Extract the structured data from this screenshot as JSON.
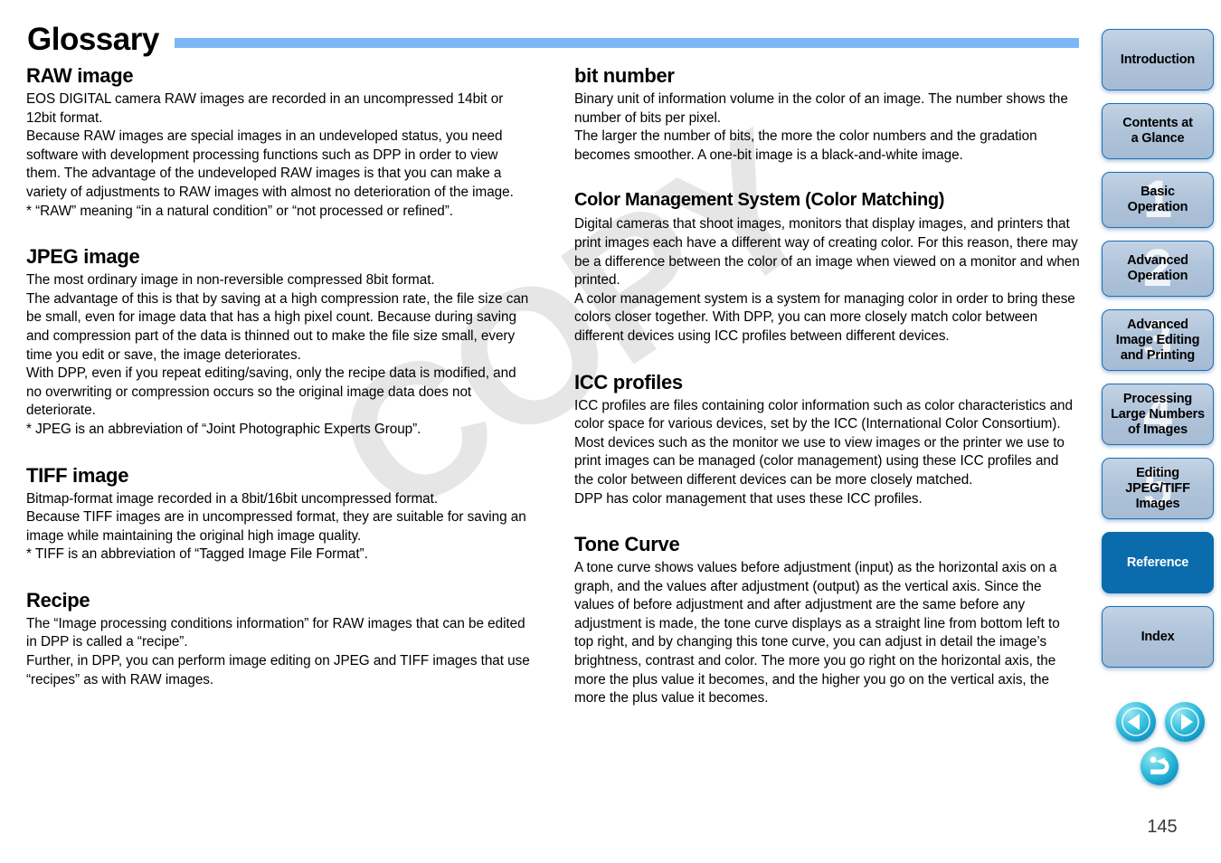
{
  "page": {
    "title": "Glossary",
    "page_number": "145",
    "watermark": "COPY",
    "rule_color": "#7db6f5"
  },
  "left_column": [
    {
      "heading": "RAW image",
      "paragraphs": [
        "EOS DIGITAL camera RAW images are recorded in an uncompressed 14bit or 12bit format.",
        "Because RAW images are special images in an undeveloped status, you need software with development processing functions such as DPP in order to view them. The advantage of the undeveloped RAW images is that you can make a variety of adjustments to RAW images with almost no deterioration of the image.",
        "* “RAW” meaning “in a natural condition” or “not processed or refined”."
      ]
    },
    {
      "heading": "JPEG image",
      "paragraphs": [
        "The most ordinary image in non-reversible compressed 8bit format.",
        "The advantage of this is that by saving at a high compression rate, the file size can be small, even for image data that has a high pixel count. Because during saving and compression part of the data is thinned out to make the file size small, every time you edit or save, the image deteriorates.",
        "With DPP, even if you repeat editing/saving, only the recipe data is modified, and no overwriting or compression occurs so the original image data does not deteriorate.",
        "* JPEG is an abbreviation of “Joint Photographic Experts Group”."
      ]
    },
    {
      "heading": "TIFF image",
      "paragraphs": [
        "Bitmap-format image recorded in a 8bit/16bit uncompressed format.",
        "Because TIFF images are in uncompressed format, they are suitable for saving an image while maintaining the original high image quality.",
        "* TIFF is an abbreviation of “Tagged Image File Format”."
      ]
    },
    {
      "heading": "Recipe",
      "paragraphs": [
        "The “Image processing conditions information” for RAW images that can be edited in DPP is called a “recipe”.",
        "Further, in DPP, you can perform image editing on JPEG and TIFF images that use “recipes” as with RAW images."
      ]
    }
  ],
  "right_column": [
    {
      "heading": "bit number",
      "paragraphs": [
        "Binary unit of information volume in the color of an image. The number shows the number of bits per pixel.",
        "The larger the number of bits, the more the color numbers and the gradation becomes smoother. A one-bit image is a black-and-white image."
      ]
    },
    {
      "heading": "Color Management System (Color Matching)",
      "paragraphs": [
        "Digital cameras that shoot images, monitors that display images, and printers that print images each have a different way of creating color. For this reason, there may be a difference between the color of an image when viewed on a monitor and when printed.",
        "A color management system is a system for managing color in order to bring these colors closer together. With DPP, you can more closely match color between different devices using ICC profiles between different devices."
      ]
    },
    {
      "heading": "ICC profiles",
      "paragraphs": [
        "ICC profiles are files containing color information such as color characteristics and color space for various devices, set by the ICC (International Color Consortium). Most devices such as the monitor we use to view images or the printer we use to print images can be managed (color management) using these ICC profiles and the color between different devices can be more closely matched.",
        "DPP has color management that uses these ICC profiles."
      ]
    },
    {
      "heading": "Tone Curve",
      "paragraphs": [
        "A tone curve shows values before adjustment (input) as the horizontal axis on a graph, and the values after adjustment (output) as the vertical axis. Since the values of before adjustment and after adjustment are the same before any adjustment is made, the tone curve displays as a straight line from bottom left to top right, and by changing this tone curve, you can adjust in detail the image’s brightness, contrast and color. The more you go right on the horizontal axis, the more the plus value it becomes, and the higher you go on the vertical axis, the more the plus value it becomes."
      ]
    }
  ],
  "sidebar": {
    "items": [
      {
        "label": "Introduction",
        "number": "",
        "active": false
      },
      {
        "label": "Contents at\na Glance",
        "number": "",
        "active": false
      },
      {
        "label": "Basic\nOperation",
        "number": "1",
        "active": false
      },
      {
        "label": "Advanced\nOperation",
        "number": "2",
        "active": false
      },
      {
        "label": "Advanced\nImage Editing\nand Printing",
        "number": "3",
        "active": false
      },
      {
        "label": "Processing\nLarge Numbers\nof Images",
        "number": "4",
        "active": false
      },
      {
        "label": "Editing\nJPEG/TIFF\nImages",
        "number": "5",
        "active": false
      },
      {
        "label": "Reference",
        "number": "",
        "active": true
      },
      {
        "label": "Index",
        "number": "",
        "active": false
      }
    ],
    "active_color": "#0a6cad",
    "inactive_color": "#b0c4da"
  },
  "nav_buttons": {
    "prev_icon": "triangle-left-icon",
    "next_icon": "triangle-right-icon",
    "return_icon": "return-arrow-icon",
    "color": "#17b0d4"
  }
}
